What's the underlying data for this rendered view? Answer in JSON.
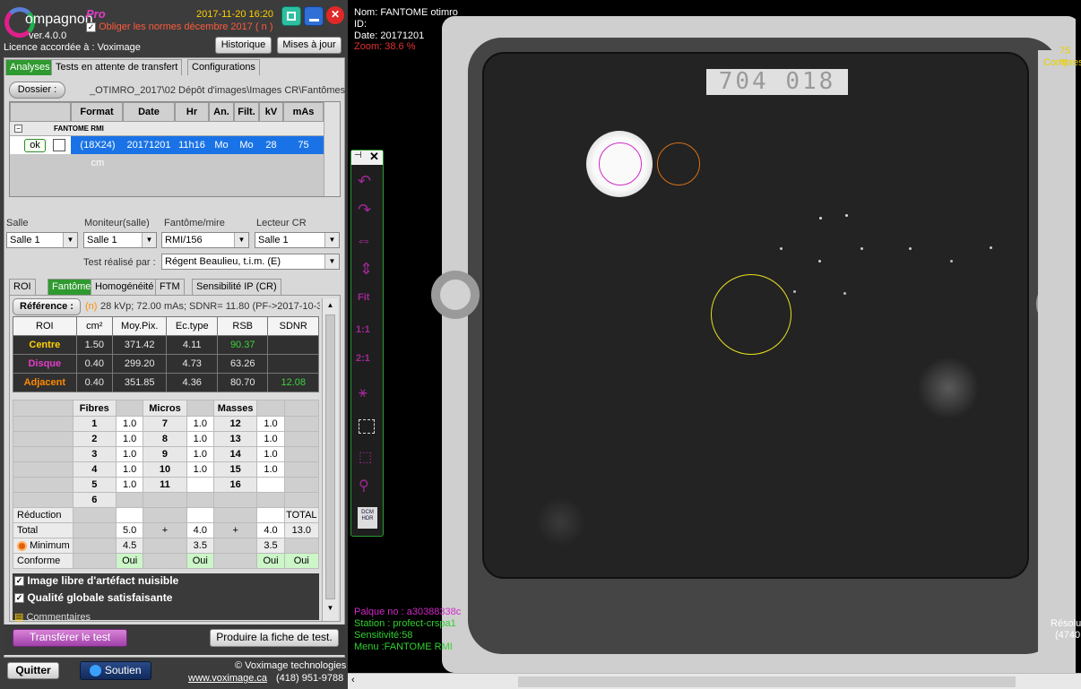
{
  "app": {
    "logo_text": "ompagnon",
    "pro": "Pro",
    "version": "ver.4.0.0",
    "licence": "Licence accordée à : Voximage",
    "datetime": "2017-11-20 16:20",
    "norms_label": "Obliger les normes décembre 2017 ( n )",
    "historique": "Historique",
    "mises_a_jour": "Mises à jour"
  },
  "tabs": [
    "Analyses",
    "Tests en attente de transfert",
    "Configurations"
  ],
  "dossier": {
    "button": "Dossier :",
    "path": "_OTIMRO_2017\\02 Dépôt d'images\\Images CR\\Fantômes"
  },
  "grid": {
    "headers": [
      "Format",
      "Date",
      "Hr",
      "An.",
      "Filt.",
      "kV",
      "mAs"
    ],
    "group": "FANTOME RMI",
    "ok": "ok",
    "row": [
      "(18X24) cm",
      "20171201",
      "11h16",
      "Mo",
      "Mo",
      "28",
      "75"
    ]
  },
  "selectors": {
    "salle_label": "Salle",
    "salle_value": "Salle 1",
    "moniteur_label": "Moniteur(salle)",
    "moniteur_value": "Salle 1",
    "fantome_label": "Fantôme/mire",
    "fantome_value": "RMI/156",
    "lecteur_label": "Lecteur CR",
    "lecteur_value": "Salle 1",
    "test_label": "Test réalisé par :",
    "test_value": "Régent Beaulieu, t.i.m. (E)"
  },
  "subtabs": [
    "ROI",
    "Fantôme",
    "Homogénéité",
    "FTM",
    "Sensibilité IP (CR)"
  ],
  "reference": {
    "button": "Référence :",
    "n": "(n)",
    "text": "28 kVp; 72.00 mAs; SDNR= 11.80 (PF->2017-10-3"
  },
  "roi_table": {
    "headers": [
      "ROI",
      "cm²",
      "Moy.Pix.",
      "Ec.type",
      "RSB",
      "SDNR"
    ],
    "rows": [
      {
        "name": "Centre",
        "cm2": "1.50",
        "moy": "371.42",
        "ec": "4.11",
        "rsb": "90.37",
        "sdnr": ""
      },
      {
        "name": "Disque",
        "cm2": "0.40",
        "moy": "299.20",
        "ec": "4.73",
        "rsb": "63.26",
        "sdnr": ""
      },
      {
        "name": "Adjacent",
        "cm2": "0.40",
        "moy": "351.85",
        "ec": "4.36",
        "rsb": "80.70",
        "sdnr": "12.08"
      }
    ],
    "colors": {
      "Centre": "#ffd000",
      "Disque": "#e23dc8",
      "Adjacent": "#ff8a00",
      "rsb_green": "#3cd23c"
    }
  },
  "fantome": {
    "fibres_header": "Fibres",
    "micros_header": "Micros",
    "masses_header": "Masses",
    "fibres": [
      [
        "1",
        "1.0"
      ],
      [
        "2",
        "1.0"
      ],
      [
        "3",
        "1.0"
      ],
      [
        "4",
        "1.0"
      ],
      [
        "5",
        "1.0"
      ],
      [
        "6",
        ""
      ]
    ],
    "micros": [
      [
        "7",
        "1.0"
      ],
      [
        "8",
        "1.0"
      ],
      [
        "9",
        "1.0"
      ],
      [
        "10",
        "1.0"
      ],
      [
        "11",
        ""
      ]
    ],
    "masses": [
      [
        "12",
        "1.0"
      ],
      [
        "13",
        "1.0"
      ],
      [
        "14",
        "1.0"
      ],
      [
        "15",
        "1.0"
      ],
      [
        "16",
        ""
      ]
    ],
    "reduction_label": "Réduction",
    "total_label": "Total",
    "minimum_label": "Minimum",
    "conforme_label": "Conforme",
    "total_header": "TOTAL",
    "plus": "+",
    "totals": [
      "5.0",
      "4.0",
      "4.0",
      "13.0"
    ],
    "minimums": [
      "4.5",
      "3.5",
      "3.5"
    ],
    "conforme": [
      "Oui",
      "Oui",
      "Oui",
      "Oui"
    ]
  },
  "checks": {
    "artefact": "Image libre d'artéfact nuisible",
    "qualite": "Qualité globale satisfaisante",
    "commentaires": "Commentaires"
  },
  "actions": {
    "transferer": "Transférer le test",
    "produire": "Produire la fiche de test.",
    "quitter": "Quitter",
    "soutien": "Soutien"
  },
  "footer": {
    "copyright": "© Voximage technologies",
    "website": "www.voximage.ca",
    "phone": "(418) 951-9788"
  },
  "image_info": {
    "nom": "Nom: FANTOME  otimro",
    "id": "ID:",
    "date": "Date: 20171201",
    "zoom": "Zoom: 38.6 %",
    "label_text": "704 018",
    "right_top1": "75 m",
    "right_top2": "Compres",
    "plaque": "Palque no : a30388338c",
    "station": "Station : profect-crspa1",
    "sensitivite": "Sensitivité:58",
    "menu": "Menu :FANTOME RMI",
    "resol1": "Résolu",
    "resol2": "(4740"
  },
  "toolbar": {
    "fit": "Fit",
    "one_one": "1:1",
    "two_one": "2:1",
    "dcm": "DCM HDR"
  }
}
